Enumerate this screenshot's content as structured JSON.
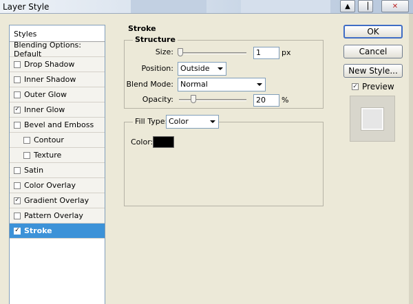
{
  "window": {
    "title": "Layer Style"
  },
  "styles_list": {
    "header": "Styles",
    "items": [
      {
        "label": "Blending Options: Default",
        "has_checkbox": false,
        "checked": false,
        "indent": false,
        "selected": false
      },
      {
        "label": "Drop Shadow",
        "has_checkbox": true,
        "checked": false,
        "indent": false,
        "selected": false
      },
      {
        "label": "Inner Shadow",
        "has_checkbox": true,
        "checked": false,
        "indent": false,
        "selected": false
      },
      {
        "label": "Outer Glow",
        "has_checkbox": true,
        "checked": false,
        "indent": false,
        "selected": false
      },
      {
        "label": "Inner Glow",
        "has_checkbox": true,
        "checked": true,
        "indent": false,
        "selected": false
      },
      {
        "label": "Bevel and Emboss",
        "has_checkbox": true,
        "checked": false,
        "indent": false,
        "selected": false
      },
      {
        "label": "Contour",
        "has_checkbox": true,
        "checked": false,
        "indent": true,
        "selected": false
      },
      {
        "label": "Texture",
        "has_checkbox": true,
        "checked": false,
        "indent": true,
        "selected": false
      },
      {
        "label": "Satin",
        "has_checkbox": true,
        "checked": false,
        "indent": false,
        "selected": false
      },
      {
        "label": "Color Overlay",
        "has_checkbox": true,
        "checked": false,
        "indent": false,
        "selected": false
      },
      {
        "label": "Gradient Overlay",
        "has_checkbox": true,
        "checked": true,
        "indent": false,
        "selected": false
      },
      {
        "label": "Pattern Overlay",
        "has_checkbox": true,
        "checked": false,
        "indent": false,
        "selected": false
      },
      {
        "label": "Stroke",
        "has_checkbox": true,
        "checked": true,
        "indent": false,
        "selected": true
      }
    ]
  },
  "stroke": {
    "section_title": "Stroke",
    "structure_title": "Structure",
    "size_label": "Size:",
    "size_value": "1",
    "size_unit": "px",
    "size_slider_fraction": 0.0,
    "position_label": "Position:",
    "position_value": "Outside",
    "blend_mode_label": "Blend Mode:",
    "blend_mode_value": "Normal",
    "opacity_label": "Opacity:",
    "opacity_value": "20",
    "opacity_unit": "%",
    "opacity_slider_fraction": 0.2,
    "fill_type_label": "Fill Type:",
    "fill_type_value": "Color",
    "color_label": "Color:",
    "color_value": "#000000"
  },
  "buttons": {
    "ok": "OK",
    "cancel": "Cancel",
    "new_style": "New Style..."
  },
  "preview": {
    "label": "Preview",
    "checked": true
  },
  "icons": {
    "check": "✓",
    "up_arrow": "▲",
    "scroll": "▕",
    "close": "✕"
  }
}
